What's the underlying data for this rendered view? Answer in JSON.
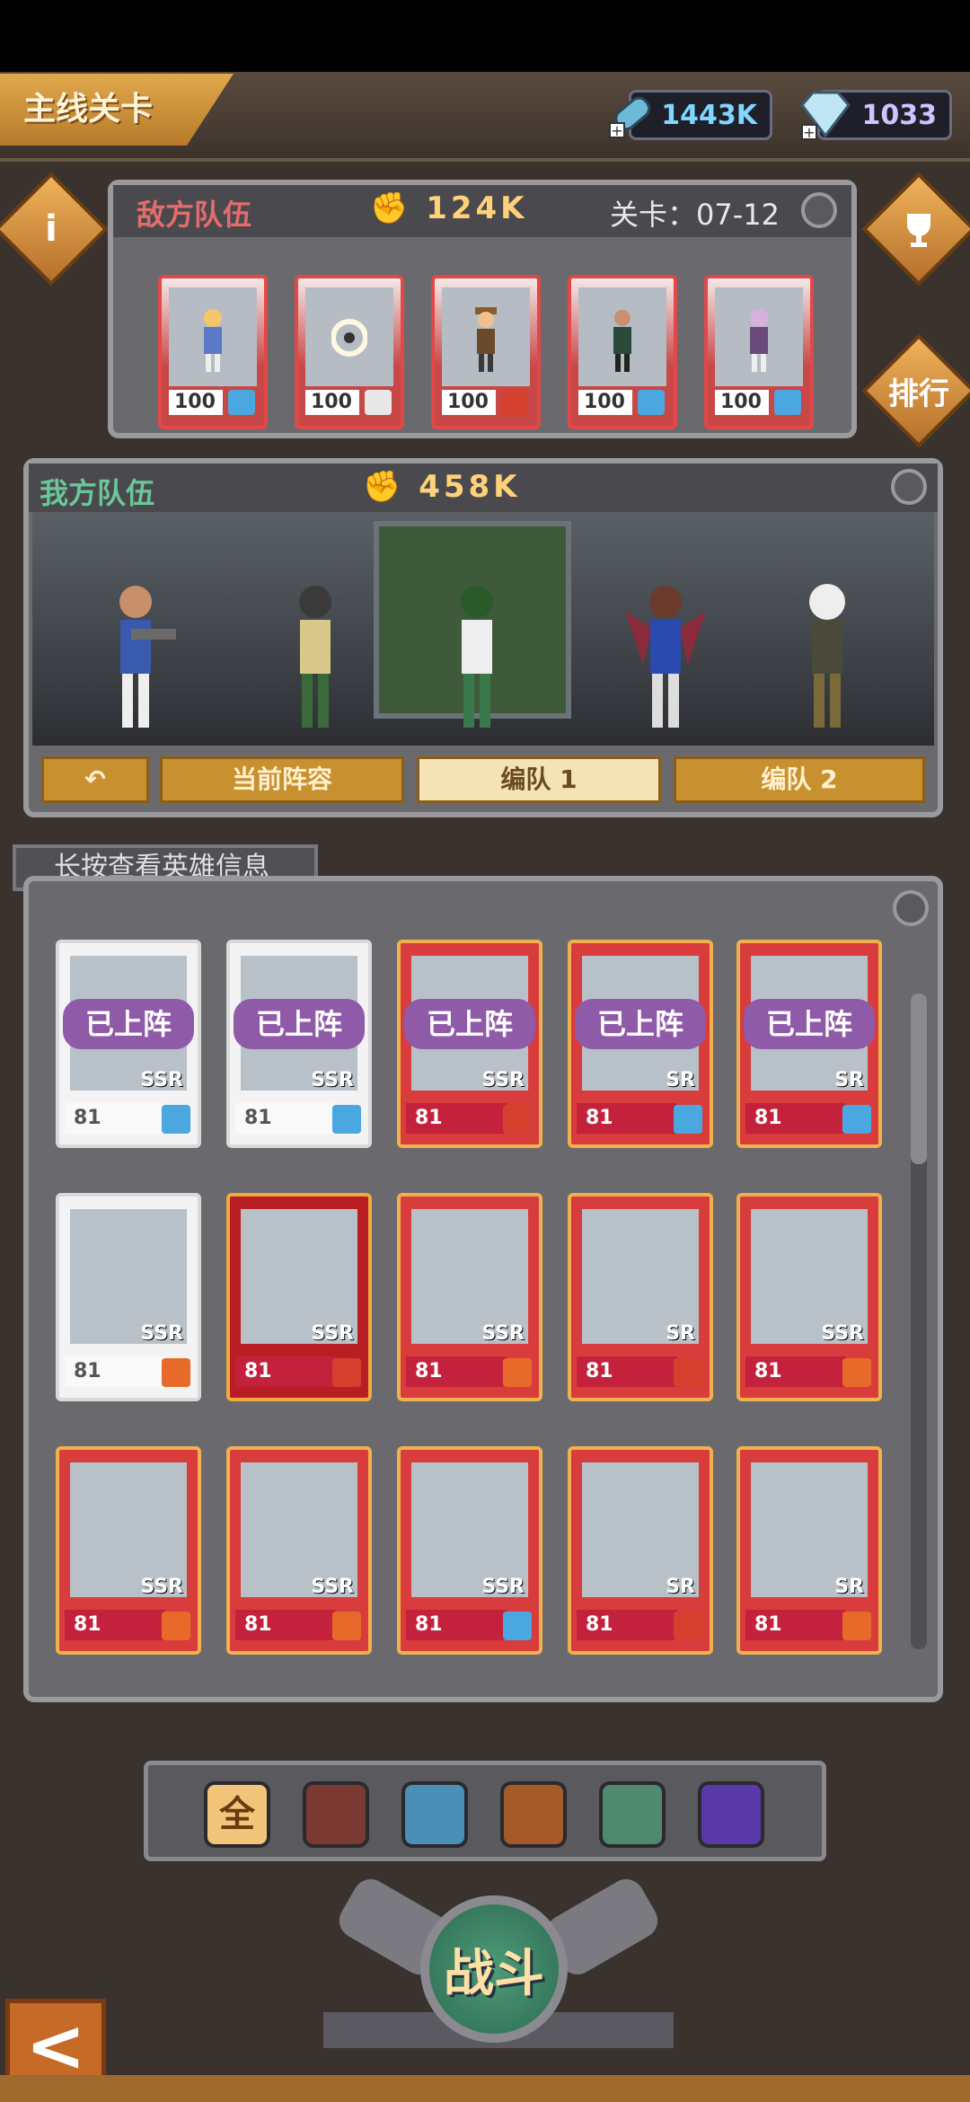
{
  "header": {
    "stage_tab": "主线关卡",
    "energy": "1443K",
    "gems": "1033"
  },
  "enemy_team": {
    "title": "敌方队伍",
    "power": "124K",
    "stage": "关卡：07-12",
    "cards": [
      {
        "level": "100",
        "element": "#4aa7e0"
      },
      {
        "level": "100",
        "element": "#e8e8e8"
      },
      {
        "level": "100",
        "element": "#d6402f"
      },
      {
        "level": "100",
        "element": "#4aa7e0"
      },
      {
        "level": "100",
        "element": "#4aa7e0"
      }
    ]
  },
  "side_buttons": {
    "info": "i",
    "rank": "排行"
  },
  "ally_team": {
    "title": "我方队伍",
    "power": "458K",
    "formation_buttons": {
      "back": "↶",
      "current": "当前阵容",
      "team1": "编队 1",
      "team2": "编队 2"
    }
  },
  "hero_list": {
    "hint": "长按查看英雄信息",
    "deployed_label": "已上阵",
    "rows": [
      [
        {
          "rank": "SSR",
          "level": "81",
          "style": "silver",
          "deployed": true,
          "element": "#4aa7e0"
        },
        {
          "rank": "SSR",
          "level": "81",
          "style": "silver",
          "deployed": true,
          "element": "#4aa7e0"
        },
        {
          "rank": "SSR",
          "level": "81",
          "style": "red",
          "deployed": true,
          "element": "#d6402f"
        },
        {
          "rank": "SR",
          "level": "81",
          "style": "red",
          "deployed": true,
          "element": "#4aa7e0"
        },
        {
          "rank": "SR",
          "level": "81",
          "style": "red",
          "deployed": true,
          "element": "#4aa7e0"
        }
      ],
      [
        {
          "rank": "SSR",
          "level": "81",
          "style": "silver",
          "deployed": false,
          "element": "#e86a2a"
        },
        {
          "rank": "SSR",
          "level": "81",
          "style": "crimson",
          "deployed": false,
          "element": "#d6402f"
        },
        {
          "rank": "SSR",
          "level": "81",
          "style": "red",
          "deployed": false,
          "element": "#e86a2a"
        },
        {
          "rank": "SR",
          "level": "81",
          "style": "red",
          "deployed": false,
          "element": "#d6402f"
        },
        {
          "rank": "SSR",
          "level": "81",
          "style": "red",
          "deployed": false,
          "element": "#e86a2a"
        }
      ],
      [
        {
          "rank": "SSR",
          "level": "81",
          "style": "red",
          "deployed": false,
          "element": "#e86a2a"
        },
        {
          "rank": "SSR",
          "level": "81",
          "style": "red",
          "deployed": false,
          "element": "#e86a2a"
        },
        {
          "rank": "SSR",
          "level": "81",
          "style": "red",
          "deployed": false,
          "element": "#4aa7e0"
        },
        {
          "rank": "SR",
          "level": "81",
          "style": "red",
          "deployed": false,
          "element": "#d6402f"
        },
        {
          "rank": "SR",
          "level": "81",
          "style": "red",
          "deployed": false,
          "element": "#e86a2a"
        }
      ]
    ]
  },
  "filters": [
    {
      "name": "all-filter",
      "label": "全",
      "color": "#f3c57a"
    },
    {
      "name": "fire-claw-filter",
      "label": "",
      "color": "#7a3a32"
    },
    {
      "name": "wolf-filter",
      "label": "",
      "color": "#4a8fb5"
    },
    {
      "name": "dragon-filter",
      "label": "",
      "color": "#a55a2a"
    },
    {
      "name": "feather-filter",
      "label": "",
      "color": "#4f8a6e"
    },
    {
      "name": "infinity-filter",
      "label": "",
      "color": "#5a3aa8"
    }
  ],
  "battle_button": "战斗",
  "back_button": "<"
}
